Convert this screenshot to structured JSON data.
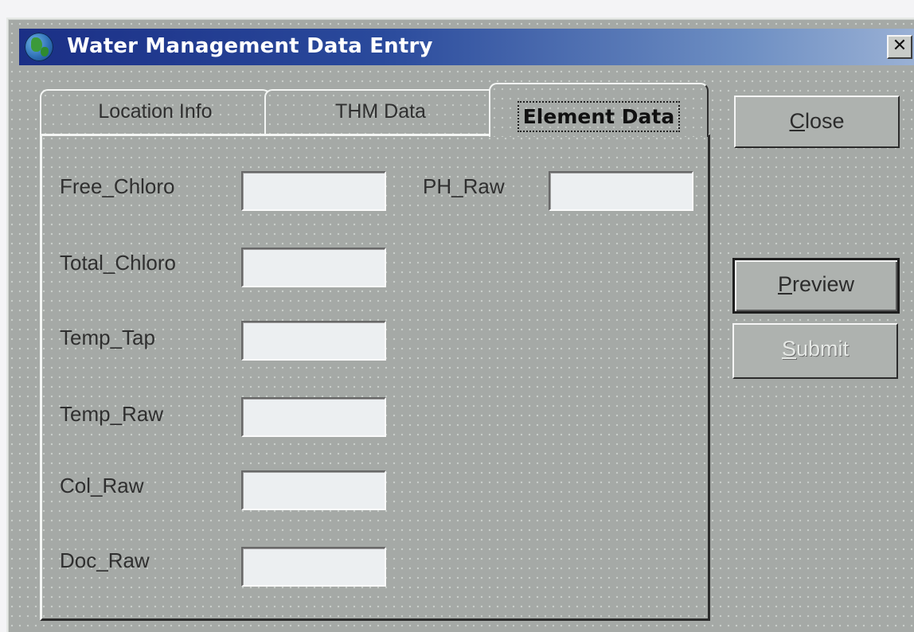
{
  "window": {
    "title": "Water Management Data Entry",
    "close_glyph": "✕",
    "icon": "globe-icon"
  },
  "tabs": [
    {
      "label": "Location Info",
      "active": false
    },
    {
      "label": "THM Data",
      "active": false
    },
    {
      "label": "Element Data",
      "active": true
    }
  ],
  "fields": {
    "free_chloro": {
      "label": "Free_Chloro",
      "value": ""
    },
    "total_chloro": {
      "label": "Total_Chloro",
      "value": ""
    },
    "temp_tap": {
      "label": "Temp_Tap",
      "value": ""
    },
    "temp_raw": {
      "label": "Temp_Raw",
      "value": ""
    },
    "col_raw": {
      "label": "Col_Raw",
      "value": ""
    },
    "doc_raw": {
      "label": "Doc_Raw",
      "value": ""
    },
    "ph_raw": {
      "label": "PH_Raw",
      "value": ""
    }
  },
  "buttons": {
    "close": {
      "accel": "C",
      "rest": "lose"
    },
    "preview": {
      "accel": "P",
      "rest": "review"
    },
    "submit": {
      "accel": "S",
      "rest": "ubmit",
      "enabled": false
    }
  },
  "colors": {
    "title_start": "#1b2f86",
    "title_end": "#9db3d6",
    "face": "#a5a9a6"
  }
}
